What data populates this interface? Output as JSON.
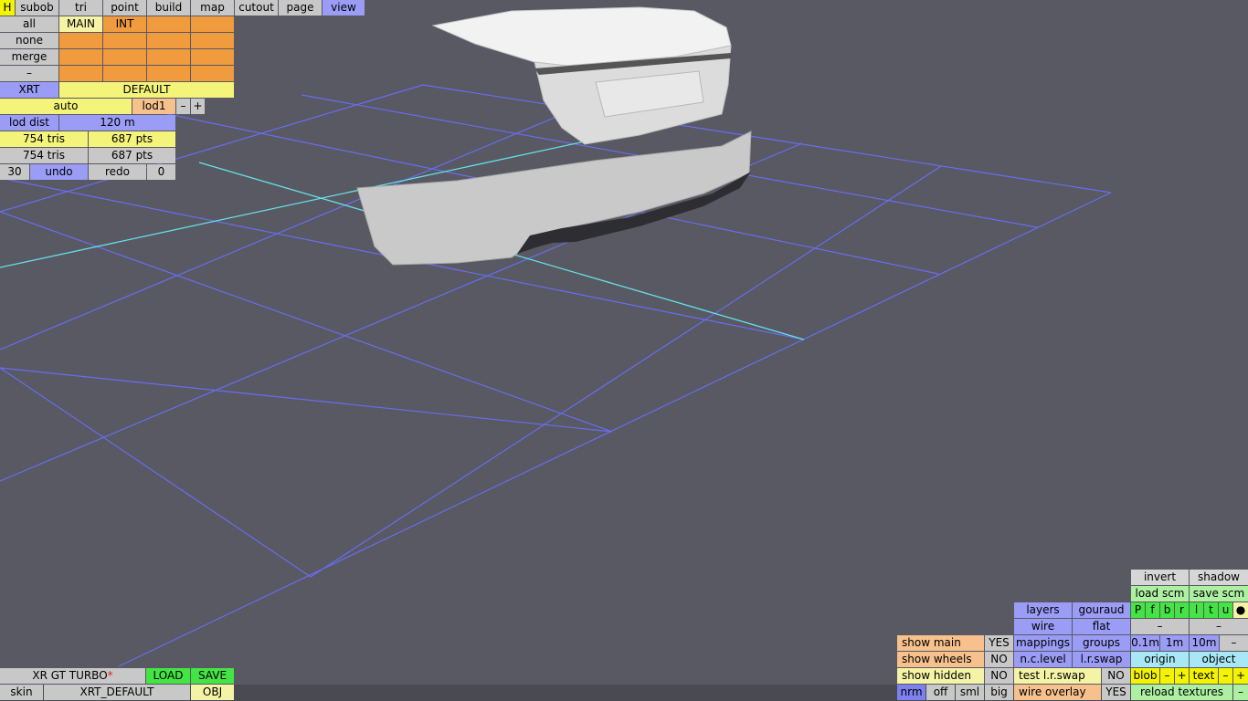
{
  "menu": {
    "h": "H",
    "items": [
      "subob",
      "tri",
      "point",
      "build",
      "map",
      "cutout",
      "page",
      "view"
    ],
    "active": "view"
  },
  "selection": {
    "all": "all",
    "none": "none",
    "merge": "merge",
    "dash": "–",
    "main": "MAIN",
    "int": "INT"
  },
  "car": {
    "code": "XRT",
    "config": "DEFAULT"
  },
  "lod": {
    "mode": "auto",
    "level": "lod1",
    "minus": "–",
    "plus": "+",
    "dist_label": "lod dist",
    "dist_value": "120 m"
  },
  "stats": {
    "row1_tris": "754 tris",
    "row1_pts": "687 pts",
    "row2_tris": "754 tris",
    "row2_pts": "687 pts"
  },
  "history": {
    "count": "30",
    "undo": "undo",
    "redo": "redo",
    "redo_count": "0"
  },
  "file": {
    "name": "XR GT TURBO",
    "modified_mark": "*",
    "load": "LOAD",
    "save": "SAVE",
    "skin_label": "skin",
    "skin_value": "XRT_DEFAULT",
    "obj": "OBJ"
  },
  "view_panel": {
    "invert": "invert",
    "shadow": "shadow",
    "load_scm": "load scm",
    "save_scm": "save scm",
    "layers": "layers",
    "gouraud": "gouraud",
    "wire": "wire",
    "flat": "flat",
    "letters": [
      "P",
      "f",
      "b",
      "r",
      "l",
      "t",
      "u",
      "●"
    ],
    "dash1": "–",
    "dash2": "–",
    "show_main": "show main",
    "show_main_val": "YES",
    "mappings": "mappings",
    "groups": "groups",
    "d01": "0.1m",
    "d1": "1m",
    "d10": "10m",
    "dminus": "–",
    "show_wheels": "show wheels",
    "show_wheels_val": "NO",
    "nc_level": "n.c.level",
    "lr_swap": "l.r.swap",
    "origin": "origin",
    "object": "object",
    "show_hidden": "show hidden",
    "show_hidden_val": "NO",
    "test_lr_swap": "test l.r.swap",
    "test_lr_swap_val": "NO",
    "blob": "blob",
    "blob_minus": "–",
    "blob_plus": "+",
    "text": "text",
    "text_minus": "–",
    "text_plus": "+",
    "nrm": "nrm",
    "off": "off",
    "sml": "sml",
    "big": "big",
    "wire_overlay": "wire overlay",
    "wire_overlay_val": "YES",
    "reload_textures": "reload textures",
    "reload_minus": "–"
  },
  "colors": {
    "background": "#585962",
    "grid": "#6a6cf0",
    "axis": "#66e0e6"
  }
}
